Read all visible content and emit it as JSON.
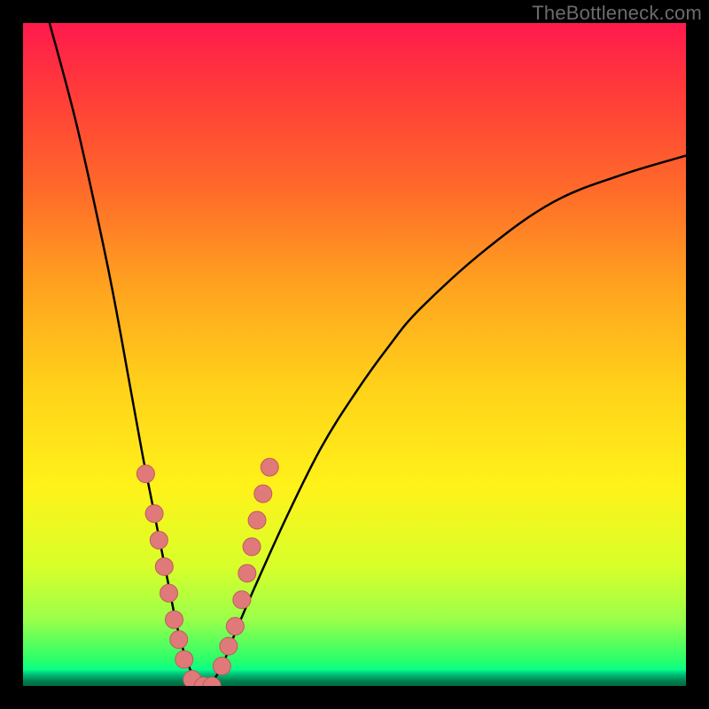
{
  "watermark": "TheBottleneck.com",
  "colors": {
    "background": "#000000",
    "curve": "#000000",
    "dot_fill": "#e07a7a",
    "dot_stroke": "#c05a5a"
  },
  "chart_data": {
    "type": "line",
    "title": "",
    "xlabel": "",
    "ylabel": "",
    "xlim": [
      0,
      100
    ],
    "ylim": [
      0,
      100
    ],
    "series": [
      {
        "name": "bottleneck-curve",
        "x": [
          4,
          8,
          12,
          14,
          16,
          18,
          19,
          20,
          21,
          22,
          23,
          24,
          25,
          26,
          27,
          28,
          30,
          32,
          35,
          40,
          45,
          50,
          55,
          60,
          70,
          80,
          90,
          100
        ],
        "y": [
          100,
          85,
          67,
          57,
          46,
          35,
          30,
          25,
          20,
          15,
          10,
          6,
          3,
          1,
          0,
          0,
          3,
          8,
          15,
          26,
          36,
          44,
          51,
          57,
          66,
          73,
          77,
          80
        ]
      }
    ],
    "markers": {
      "name": "highlight-dots",
      "x": [
        18.5,
        19.8,
        20.5,
        21.3,
        22.0,
        22.8,
        23.5,
        24.3,
        25.5,
        27.2,
        28.5,
        30.0,
        31.0,
        32.0,
        33.0,
        33.8,
        34.5,
        35.3,
        36.2,
        37.2
      ],
      "y": [
        32,
        26,
        22,
        18,
        14,
        10,
        7,
        4,
        1,
        0,
        0,
        3,
        6,
        9,
        13,
        17,
        21,
        25,
        29,
        33
      ]
    }
  }
}
